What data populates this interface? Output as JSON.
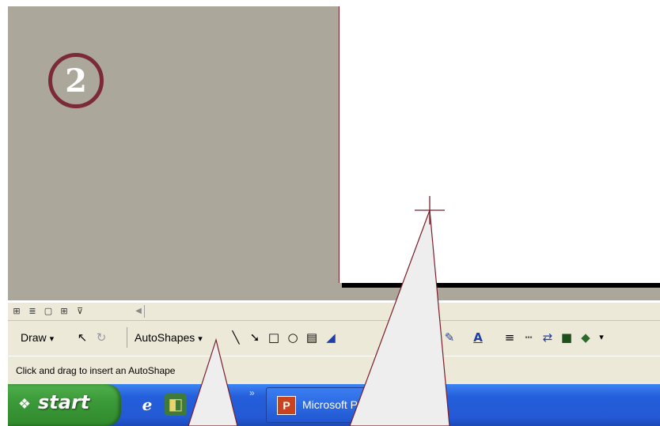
{
  "step": {
    "number": "2"
  },
  "view_bar": {
    "buttons": [
      {
        "name": "normal-view-icon",
        "glyph": "⊞"
      },
      {
        "name": "outline-view-icon",
        "glyph": "≣"
      },
      {
        "name": "slide-view-icon",
        "glyph": "▢"
      },
      {
        "name": "slide-sorter-view-icon",
        "glyph": "⊞"
      },
      {
        "name": "slide-show-icon",
        "glyph": "⊽"
      }
    ],
    "scroll_glyph": "◀"
  },
  "draw_toolbar": {
    "draw_label": "Draw",
    "draw_arrow": "▾",
    "select_glyph": "↖",
    "rotate_glyph": "↻",
    "autoshapes_label": "AutoShapes",
    "autoshapes_arrow": "▾",
    "line_glyph": "╲",
    "arrow_glyph": "➘",
    "rectangle_glyph": "□",
    "oval_glyph": "○",
    "textbox_glyph": "▤",
    "wordart_glyph": "◢",
    "line_color_glyph": "✎",
    "font_color_glyph": "A",
    "line_style_glyph": "≡",
    "dash_style_glyph": "┅",
    "arrow_style_glyph": "⇄",
    "shadow_glyph": "■",
    "threed_glyph": "◆",
    "more_glyph": "▾"
  },
  "status": {
    "text": "Click and drag to insert an AutoShape"
  },
  "taskbar": {
    "start_label": "start",
    "start_logo": "❖",
    "ie_glyph": "e",
    "ql2_glyph": "◧",
    "chevron": "»",
    "task_label": "Microsoft PowerPoint",
    "task_icon": "P"
  },
  "colors": {
    "workspace": "#aba89b",
    "badge_ring": "#7b2a36",
    "callout_stroke": "#7a1f2b",
    "callout_fill": "#eeeeee",
    "taskbar": "#245edb",
    "start": "#3c9a39"
  }
}
